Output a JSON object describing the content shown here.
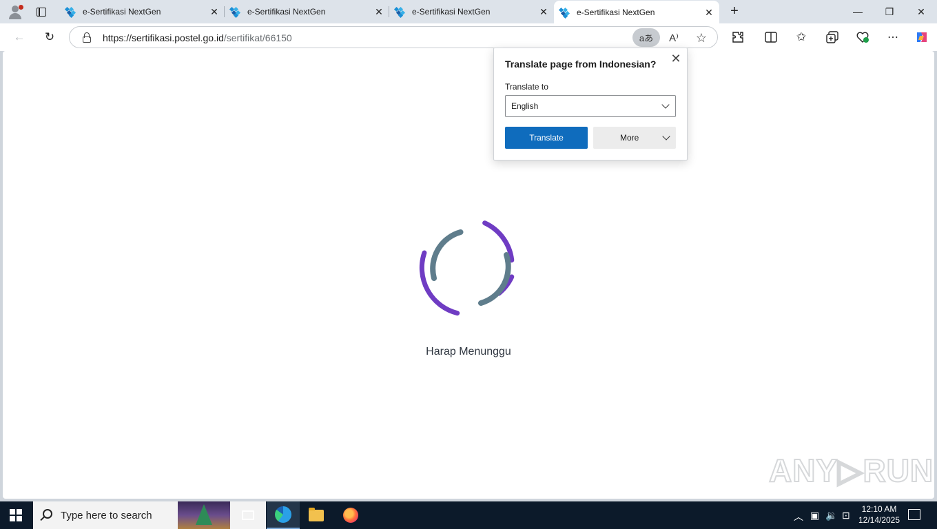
{
  "browser": {
    "tabs": [
      {
        "title": "e-Sertifikasi NextGen",
        "active": false
      },
      {
        "title": "e-Sertifikasi NextGen",
        "active": false
      },
      {
        "title": "e-Sertifikasi NextGen",
        "active": false
      },
      {
        "title": "e-Sertifikasi NextGen",
        "active": true
      }
    ],
    "new_tab_glyph": "+",
    "close_glyph": "✕",
    "window_controls": {
      "minimize": "—",
      "restore": "❐",
      "close": "✕"
    },
    "address": {
      "host": "https://sertifikasi.postel.go.id",
      "path": "/sertifikat/66150"
    },
    "translate_chip_text": "aあ",
    "read_aloud_text": "A⁾",
    "icons": [
      "back-icon",
      "refresh-icon",
      "lock-icon",
      "translate-icon",
      "read-aloud-icon",
      "favorite-star-icon",
      "extensions-icon",
      "split-screen-icon",
      "favorites-icon",
      "collections-icon",
      "browser-essentials-icon",
      "more-icon",
      "copilot-icon"
    ]
  },
  "translate_popup": {
    "title": "Translate page from Indonesian?",
    "label": "Translate to",
    "selected_language": "English",
    "translate_button": "Translate",
    "more_button": "More",
    "close_glyph": "✕"
  },
  "page": {
    "loading_text": "Harap Menunggu",
    "spinner_colors": {
      "outer": "#6f3cc3",
      "inner": "#5f7d8c"
    },
    "watermark": "ANY RUN"
  },
  "taskbar": {
    "search_placeholder": "Type here to search",
    "time": "12:10 AM",
    "date": "12/14/2025",
    "apps": [
      "task-view-icon",
      "edge-icon",
      "file-explorer-icon",
      "firefox-icon"
    ]
  }
}
